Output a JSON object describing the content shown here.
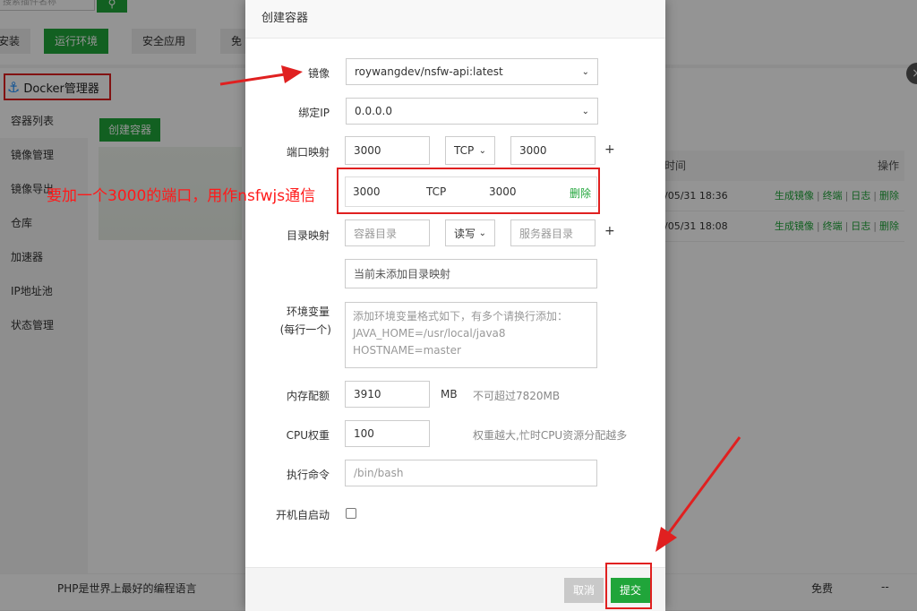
{
  "topbar": {
    "search_placeholder": "搜索插件名称",
    "nav": [
      "安装",
      "运行环境",
      "安全应用",
      "免"
    ]
  },
  "docker": {
    "title": "Docker管理器",
    "close": "×",
    "menu": [
      "容器列表",
      "镜像管理",
      "镜像导出",
      "仓库",
      "加速器",
      "IP地址池",
      "状态管理"
    ],
    "create_button": "创建容器",
    "table": {
      "headers": [
        "时间",
        "操作"
      ],
      "rows": [
        {
          "time": "/05/31 18:36",
          "ops": [
            "生成镜像",
            "终端",
            "日志",
            "删除"
          ]
        },
        {
          "time": "/05/31 18:08",
          "ops": [
            "生成镜像",
            "终端",
            "日志",
            "删除"
          ]
        }
      ]
    }
  },
  "footer": {
    "slogan": "PHP是世界上最好的编程语言",
    "price": "免费",
    "dash": "--"
  },
  "annotation": {
    "note": "要加一个3000的端口，用作nsfwjs通信"
  },
  "modal": {
    "title": "创建容器",
    "image_label": "镜像",
    "image_value": "roywangdev/nsfw-api:latest",
    "bind_ip_label": "绑定IP",
    "bind_ip_value": "0.0.0.0",
    "port_label": "端口映射",
    "port_host": "3000",
    "port_protocol": "TCP",
    "port_container": "3000",
    "plus": "+",
    "added_port": {
      "host": "3000",
      "protocol": "TCP",
      "container": "3000",
      "delete": "删除"
    },
    "dir_label": "目录映射",
    "dir_container_placeholder": "容器目录",
    "dir_mode": "读写",
    "dir_server_placeholder": "服务器目录",
    "dir_empty": "当前未添加目录映射",
    "env_label": "环境变量",
    "env_label_sub": "(每行一个)",
    "env_placeholder_lines": [
      "添加环境变量格式如下，有多个请换行添加：",
      "JAVA_HOME=/usr/local/java8",
      "HOSTNAME=master"
    ],
    "memory_label": "内存配额",
    "memory_value": "3910",
    "memory_unit": "MB",
    "memory_hint": "不可超过7820MB",
    "cpu_label": "CPU权重",
    "cpu_value": "100",
    "cpu_hint": "权重越大,忙时CPU资源分配越多",
    "cmd_label": "执行命令",
    "cmd_placeholder": "/bin/bash",
    "autostart_label": "开机自启动",
    "cancel": "取消",
    "submit": "提交"
  },
  "colors": {
    "accent": "#20a53a",
    "annotation": "#e02020"
  }
}
